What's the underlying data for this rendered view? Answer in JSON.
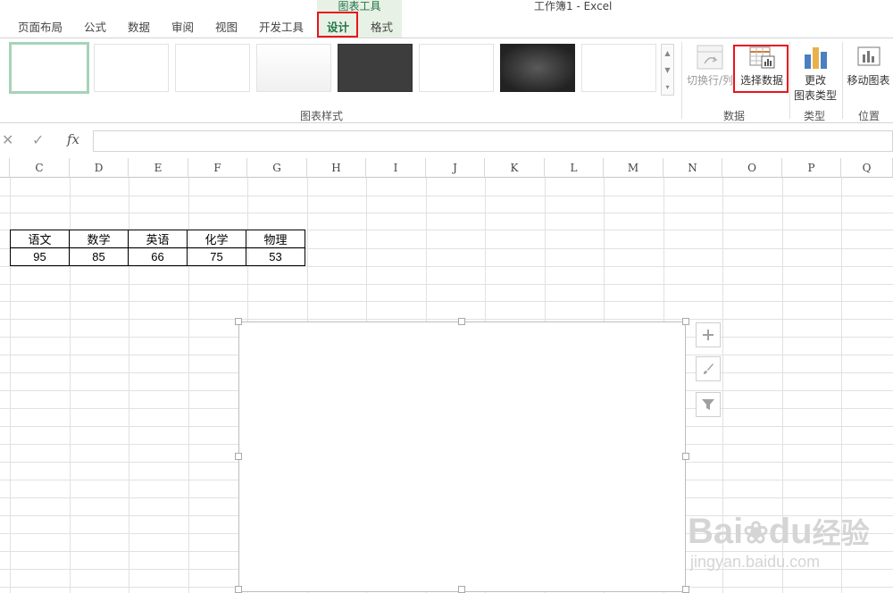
{
  "window": {
    "title": "工作簿1 - Excel"
  },
  "contextual_tab_group": {
    "label": "图表工具"
  },
  "tabs": [
    {
      "label": "页面布局"
    },
    {
      "label": "公式"
    },
    {
      "label": "数据"
    },
    {
      "label": "审阅"
    },
    {
      "label": "视图"
    },
    {
      "label": "开发工具"
    },
    {
      "label": "设计",
      "active": true
    },
    {
      "label": "格式"
    }
  ],
  "ribbon": {
    "chart_styles": {
      "group_label": "图表样式",
      "thumbnail_count": 8,
      "selected_index": 0
    },
    "data": {
      "group_label": "数据",
      "switch_row_col": "切换行/列",
      "select_data": "选择数据"
    },
    "type": {
      "group_label": "类型",
      "change_chart_type_line1": "更改",
      "change_chart_type_line2": "图表类型"
    },
    "location": {
      "group_label": "位置",
      "move_chart": "移动图表"
    }
  },
  "formula_bar": {
    "cancel_icon": "✕",
    "enter_icon": "✓",
    "fx_label": "fx",
    "value": ""
  },
  "columns": [
    "C",
    "D",
    "E",
    "F",
    "G",
    "H",
    "I",
    "J",
    "K",
    "L",
    "M",
    "N",
    "O",
    "P",
    "Q"
  ],
  "table": {
    "headers": [
      "语文",
      "数学",
      "英语",
      "化学",
      "物理"
    ],
    "values": [
      "95",
      "85",
      "66",
      "75",
      "53"
    ]
  },
  "chart_side_buttons": [
    "chart-elements-plus-icon",
    "chart-styles-brush-icon",
    "chart-filter-funnel-icon"
  ],
  "watermark": {
    "brand": "Bai",
    "brand2": "du",
    "brand_cn": "经验",
    "url": "jingyan.baidu.com"
  },
  "colors": {
    "accent": "#217346",
    "highlight": "#e8141c",
    "selected_style_border": "#a6d3b8"
  }
}
